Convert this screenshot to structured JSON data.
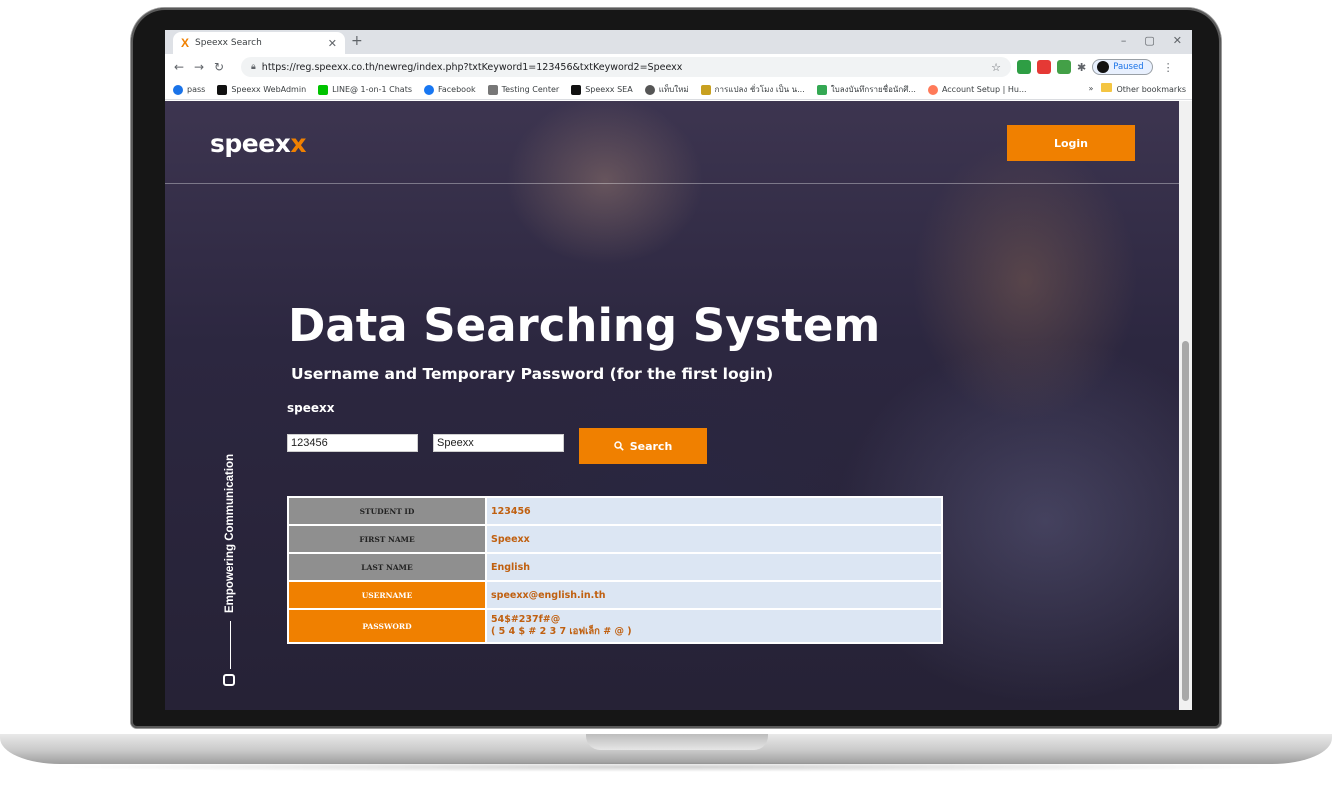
{
  "browser": {
    "tab_title": "Speexx Search",
    "new_tab": "+",
    "window_controls": [
      "–",
      "▢",
      "✕"
    ],
    "url": "https://reg.speexx.co.th/newreg/index.php?txtKeyword1=123456&txtKeyword2=Speexx",
    "profile_status": "Paused",
    "bookmarks": [
      {
        "label": "pass",
        "color": "#1a73e8"
      },
      {
        "label": "Speexx WebAdmin",
        "color": "#111111"
      },
      {
        "label": "LINE@ 1-on-1 Chats",
        "color": "#00c300"
      },
      {
        "label": "Facebook",
        "color": "#1877f2"
      },
      {
        "label": "Testing Center",
        "color": "#777777"
      },
      {
        "label": "Speexx SEA",
        "color": "#111111"
      },
      {
        "label": "แท็บใหม่",
        "color": "#555555"
      },
      {
        "label": "การแปลง ชั่วโมง เป็น น...",
        "color": "#c8a020"
      },
      {
        "label": "ใบลงบันทึกรายชื่อนักศึ...",
        "color": "#34a853"
      },
      {
        "label": "Account Setup | Hu...",
        "color": "#ff7a59"
      }
    ],
    "bookmarks_overflow": "»",
    "other_bookmarks": "Other bookmarks"
  },
  "page": {
    "brand_main": "speex",
    "brand_accent": "x",
    "login_label": "Login",
    "hero_title": "Data Searching System",
    "hero_subtitle": "Username and Temporary Password (for the first login)",
    "form_label": "speexx",
    "input_student_id": "123456",
    "input_name": "Speexx",
    "search_label": "Search",
    "side_text": "Empowering Communication",
    "results": {
      "student_id_label": "STUDENT ID",
      "student_id": "123456",
      "first_name_label": "FIRST NAME",
      "first_name": "Speexx",
      "last_name_label": "LAST NAME",
      "last_name": "English",
      "username_label": "USERNAME",
      "username": "speexx@english.in.th",
      "password_label": "PASSWORD",
      "password": "54$#237f#@",
      "password_spelled": "( 5 4 $ # 2 3 7 เอฟเล็ก # @ )"
    }
  },
  "colors": {
    "accent": "#f08000",
    "table_key_bg": "#8f8f8f",
    "table_value_bg": "#dce6f3"
  }
}
